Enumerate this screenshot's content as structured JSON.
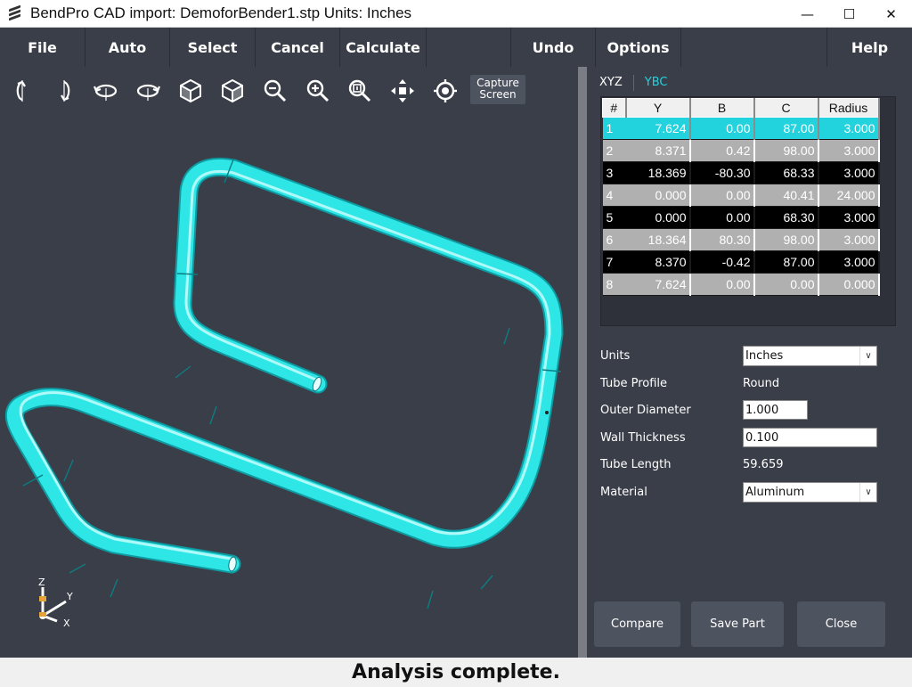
{
  "window": {
    "title": "BendPro CAD import: DemoforBender1.stp  Units: Inches",
    "controls": [
      "minimize-icon",
      "maximize-icon",
      "close-icon"
    ]
  },
  "menu": [
    "File",
    "Auto",
    "Select",
    "Cancel",
    "Calculate",
    "",
    "Undo",
    "Options",
    "",
    "Help"
  ],
  "toolbar": {
    "icons": [
      "rotate-x-icon",
      "rotate-y-icon",
      "rotate-ccw-icon",
      "rotate-cw-icon",
      "iso-cube-left-icon",
      "iso-cube-right-icon",
      "zoom-out-icon",
      "zoom-in-icon",
      "zoom-fit-icon",
      "pan-icon",
      "center-target-icon"
    ],
    "capture_line1": "Capture",
    "capture_line2": "Screen"
  },
  "axis": {
    "z": "Z",
    "y": "Y",
    "x": "X"
  },
  "tabs": {
    "xyz": "XYZ",
    "ybc": "YBC",
    "active": "YBC"
  },
  "grid": {
    "headers": [
      "#",
      "Y",
      "B",
      "C",
      "Radius"
    ],
    "rows": [
      [
        "1",
        "7.624",
        "0.00",
        "87.00",
        "3.000"
      ],
      [
        "2",
        "8.371",
        "0.42",
        "98.00",
        "3.000"
      ],
      [
        "3",
        "18.369",
        "-80.30",
        "68.33",
        "3.000"
      ],
      [
        "4",
        "0.000",
        "0.00",
        "40.41",
        "24.000"
      ],
      [
        "5",
        "0.000",
        "0.00",
        "68.30",
        "3.000"
      ],
      [
        "6",
        "18.364",
        "80.30",
        "98.00",
        "3.000"
      ],
      [
        "7",
        "8.370",
        "-0.42",
        "87.00",
        "3.000"
      ],
      [
        "8",
        "7.624",
        "0.00",
        "0.00",
        "0.000"
      ]
    ]
  },
  "props": {
    "units_label": "Units",
    "units_value": "Inches",
    "profile_label": "Tube Profile",
    "profile_value": "Round",
    "od_label": "Outer Diameter",
    "od_value": "1.000",
    "wall_label": "Wall Thickness",
    "wall_value": "0.100",
    "length_label": "Tube Length",
    "length_value": "59.659",
    "material_label": "Material",
    "material_value": "Aluminum"
  },
  "buttons": {
    "compare": "Compare",
    "save": "Save Part",
    "close": "Close"
  },
  "status": "Analysis complete.",
  "colors": {
    "accent": "#22d2dc",
    "background": "#3a3e48",
    "tube": "#2ee6e6"
  }
}
